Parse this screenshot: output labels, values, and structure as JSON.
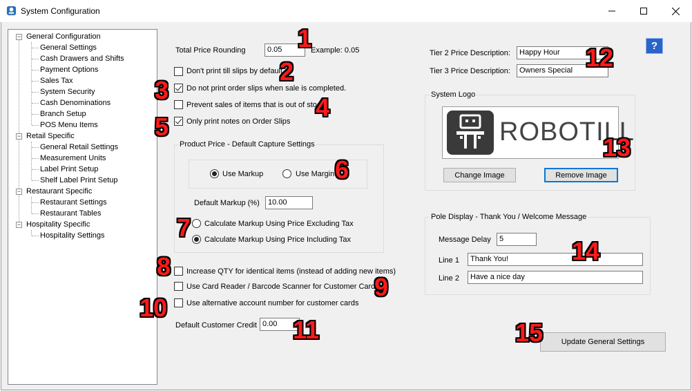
{
  "window": {
    "title": "System Configuration",
    "minimize_symbol": "—",
    "maximize_symbol": "☐",
    "close_symbol": "✕"
  },
  "tree": {
    "groups": [
      {
        "label": "General Configuration",
        "children": [
          "General Settings",
          "Cash Drawers and Shifts",
          "Payment Options",
          "Sales Tax",
          "System Security",
          "Cash Denominations",
          "Branch Setup",
          "POS Menu Items"
        ]
      },
      {
        "label": "Retail Specific",
        "children": [
          "General Retail Settings",
          "Measurement Units",
          "Label Print Setup",
          "Shelf Label Print Setup"
        ]
      },
      {
        "label": "Restaurant Specific",
        "children": [
          "Restaurant Settings",
          "Restaurant Tables"
        ]
      },
      {
        "label": "Hospitality Specific",
        "children": [
          "Hospitality Settings"
        ]
      }
    ],
    "expander_symbol": "−"
  },
  "general": {
    "total_price_rounding_label": "Total Price Rounding",
    "total_price_rounding_value": "0.05",
    "example_label": "Example: 0.05",
    "dont_print_till_slips": {
      "label": "Don't print till slips by default",
      "checked": false
    },
    "no_print_order_slips": {
      "label": "Do not print order slips when sale is completed.",
      "checked": true
    },
    "prevent_sales_out_of_stock": {
      "label": "Prevent sales of items that is out of stock",
      "checked": false
    },
    "only_print_notes": {
      "label": "Only print notes on Order Slips",
      "checked": true
    }
  },
  "capture": {
    "group_title": "Product  Price - Default Capture Settings",
    "use_markup_label": "Use Markup",
    "use_markup_selected": true,
    "use_margin_label": "Use Margin",
    "default_markup_label": "Default Markup (%)",
    "default_markup_value": "10.00",
    "calc_excluding_tax_label": "Calculate Markup Using Price Excluding Tax",
    "calc_including_tax_label": "Calculate Markup Using Price Including Tax",
    "including_tax_selected": true
  },
  "customer": {
    "increase_qty": {
      "label": "Increase QTY for identical items (instead of adding new items)",
      "checked": false
    },
    "card_reader": {
      "label": "Use Card Reader / Barcode Scanner for Customer Cards",
      "checked": false
    },
    "alt_account_number": {
      "label": "Use alternative account number for customer cards",
      "checked": false
    },
    "default_credit_label": "Default Customer Credit",
    "default_credit_value": "0.00"
  },
  "tiers": {
    "tier2_label": "Tier 2 Price Description:",
    "tier2_value": "Happy Hour",
    "tier3_label": "Tier 3 Price Description:",
    "tier3_value": "Owners Special"
  },
  "help_button": "?",
  "logo": {
    "group_title": "System Logo",
    "brand_text": "ROBOTILL",
    "change_image_label": "Change Image",
    "remove_image_label": "Remove Image"
  },
  "pole_display": {
    "group_title": "Pole Display - Thank You / Welcome Message",
    "message_delay_label": "Message Delay",
    "message_delay_value": "5",
    "line1_label": "Line 1",
    "line1_value": "Thank You!",
    "line2_label": "Line 2",
    "line2_value": "Have a nice day"
  },
  "update_button_label": "Update General Settings",
  "annotations": [
    "1",
    "2",
    "3",
    "4",
    "5",
    "6",
    "7",
    "8",
    "9",
    "10",
    "11",
    "12",
    "13",
    "14",
    "15"
  ],
  "colors": {
    "accent": "#0078d7",
    "annotation": "#ff1a1a",
    "logo_bg": "#3a3a3a"
  }
}
